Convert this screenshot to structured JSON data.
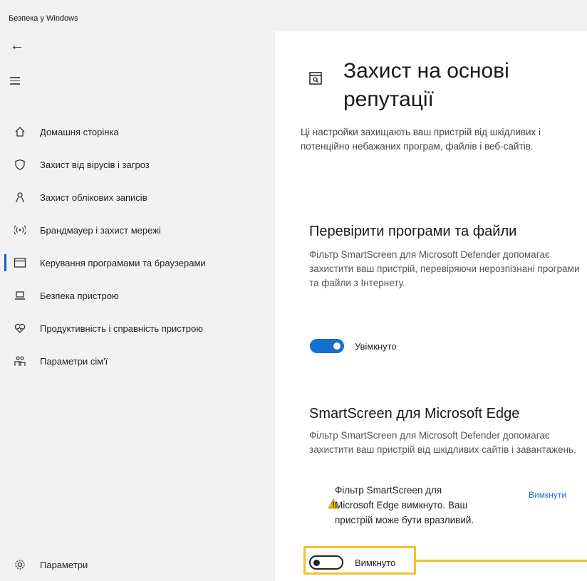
{
  "window": {
    "title": "Безпека у Windows"
  },
  "sidebar": {
    "back_icon": "back-arrow-icon",
    "menu_icon": "hamburger-icon",
    "items": [
      {
        "label": "Домашня сторінка",
        "icon": "home-icon"
      },
      {
        "label": "Захист від вірусів і загроз",
        "icon": "shield-icon"
      },
      {
        "label": "Захист облікових записів",
        "icon": "person-icon"
      },
      {
        "label": "Брандмауер і захист мережі",
        "icon": "network-icon"
      },
      {
        "label": "Керування програмами та браузерами",
        "icon": "app-browser-icon",
        "active": true
      },
      {
        "label": "Безпека пристрою",
        "icon": "laptop-icon"
      },
      {
        "label": "Продуктивність і справність пристрою",
        "icon": "heart-icon"
      },
      {
        "label": "Параметри сім'ї",
        "icon": "family-icon"
      }
    ],
    "settings": {
      "label": "Параметри",
      "icon": "gear-icon"
    }
  },
  "main": {
    "title": "Захист на основі репутації",
    "description": "Ці настройки захищають ваш пристрій від шкідливих і потенційно небажаних програм, файлів і веб-сайтів.",
    "sections": [
      {
        "title": "Перевірити програми та файли",
        "description": "Фільтр SmartScreen для Microsoft Defender допомагає захистити ваш пристрій, перевіряючи нерозпізнані програми та файли з Інтернету.",
        "toggle_state": "on",
        "toggle_label": "Увімкнуто"
      },
      {
        "title": "SmartScreen для Microsoft Edge",
        "description": "Фільтр SmartScreen для Microsoft Defender допомагає захистити ваш пристрій від шкідливих сайтів і завантажень.",
        "warning": "Фільтр SmartScreen для Microsoft Edge вимкнуто. Ваш пристрій може бути вразливий.",
        "warning_action": "Вимкнути",
        "toggle_state": "off",
        "toggle_label": "Вимкнуто"
      }
    ]
  },
  "colors": {
    "accent": "#1470c8",
    "highlight": "#f3c02c",
    "warning": "#f1b500",
    "sidebar_bg": "#f2f2f2"
  }
}
